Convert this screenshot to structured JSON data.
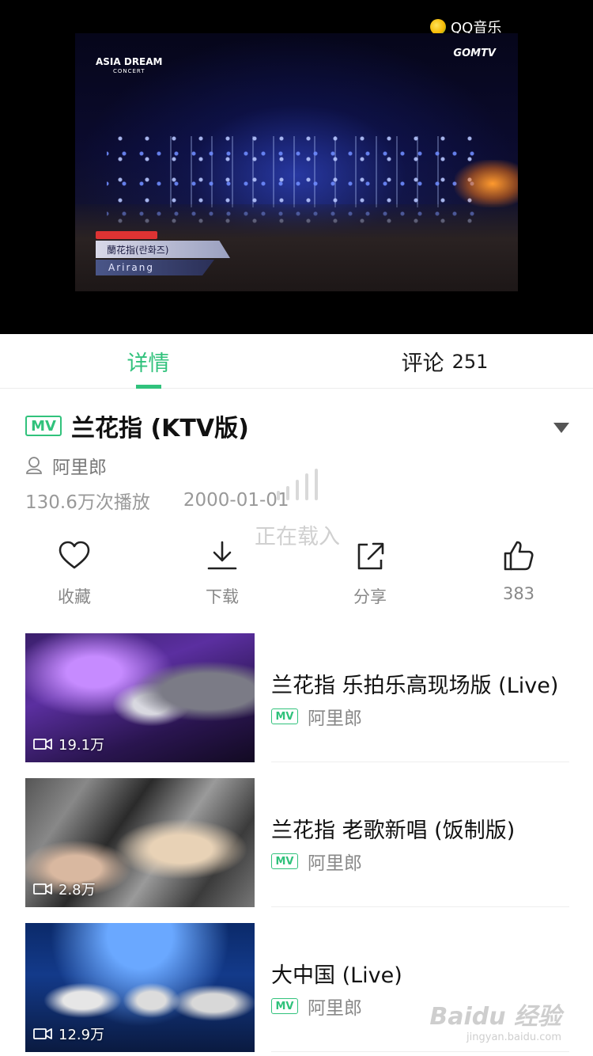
{
  "player": {
    "brand": "QQ音乐",
    "video_overlay": {
      "concert_logo": "ASIA DREAM",
      "concert_sub": "CONCERT",
      "channel_logo": "GOMTV",
      "caption_line1": "蘭花指(란화즈)",
      "caption_line2": "Arirang"
    }
  },
  "tabs": {
    "detail": "详情",
    "comments": "评论",
    "comments_count": "251"
  },
  "song": {
    "badge": "MV",
    "title": "兰花指 (KTV版)",
    "artist": "阿里郎",
    "plays": "130.6万次播放",
    "date": "2000-01-01"
  },
  "loading": {
    "text": "正在载入"
  },
  "actions": {
    "favorite": "收藏",
    "download": "下载",
    "share": "分享",
    "like_count": "383"
  },
  "related": [
    {
      "title": "兰花指 乐拍乐高现场版 (Live)",
      "badge": "MV",
      "artist": "阿里郎",
      "views": "19.1万"
    },
    {
      "title": "兰花指 老歌新唱 (饭制版)",
      "badge": "MV",
      "artist": "阿里郎",
      "views": "2.8万"
    },
    {
      "title": "大中国 (Live)",
      "badge": "MV",
      "artist": "阿里郎",
      "views": "12.9万"
    }
  ],
  "watermark": {
    "main": "Baidu 经验",
    "url": "jingyan.baidu.com"
  },
  "colors": {
    "accent": "#31c27c",
    "text": "#111111",
    "secondary": "#888888"
  }
}
